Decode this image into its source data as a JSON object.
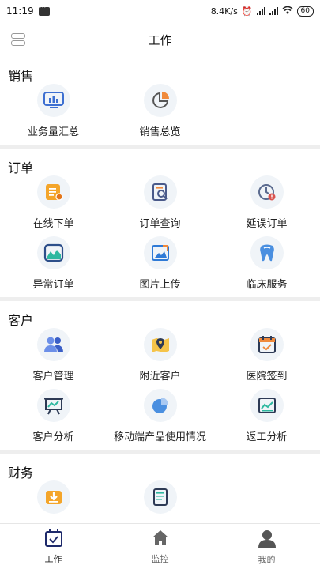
{
  "status": {
    "time": "11:19",
    "speed": "8.4K/s",
    "battery": "60"
  },
  "header": {
    "title": "工作"
  },
  "sections": [
    {
      "title": "销售",
      "items": [
        {
          "label": "业务量汇总",
          "icon": "bar-chart-icon"
        },
        {
          "label": "销售总览",
          "icon": "pie-chart-icon"
        }
      ]
    },
    {
      "title": "订单",
      "items": [
        {
          "label": "在线下单",
          "icon": "order-list-icon"
        },
        {
          "label": "订单查询",
          "icon": "search-doc-icon"
        },
        {
          "label": "延误订单",
          "icon": "clock-warning-icon"
        },
        {
          "label": "异常订单",
          "icon": "abnormal-chart-icon"
        },
        {
          "label": "图片上传",
          "icon": "image-upload-icon"
        },
        {
          "label": "临床服务",
          "icon": "tooth-icon"
        }
      ]
    },
    {
      "title": "客户",
      "items": [
        {
          "label": "客户管理",
          "icon": "users-icon"
        },
        {
          "label": "附近客户",
          "icon": "map-pin-icon"
        },
        {
          "label": "医院签到",
          "icon": "calendar-check-icon"
        },
        {
          "label": "客户分析",
          "icon": "presentation-icon"
        },
        {
          "label": "移动端产品使用情况",
          "icon": "pie-usage-icon"
        },
        {
          "label": "返工分析",
          "icon": "trend-board-icon"
        }
      ]
    },
    {
      "title": "财务",
      "items": [
        {
          "label": "",
          "icon": "download-tray-icon"
        },
        {
          "label": "",
          "icon": "invoice-icon"
        }
      ]
    }
  ],
  "tabs": [
    {
      "label": "工作",
      "icon": "calendar-check-icon",
      "active": true
    },
    {
      "label": "监控",
      "icon": "home-icon",
      "active": false
    },
    {
      "label": "我的",
      "icon": "user-icon",
      "active": false
    }
  ]
}
